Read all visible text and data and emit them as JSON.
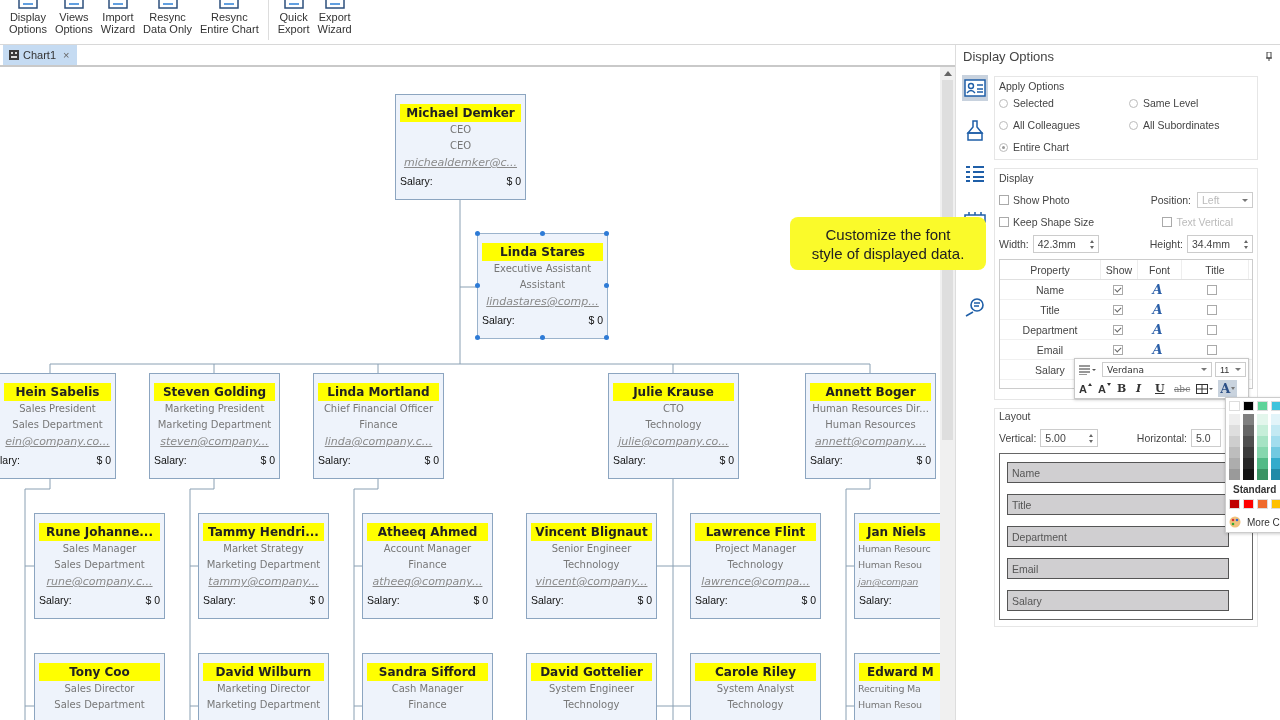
{
  "toolbar": {
    "groups": [
      [
        {
          "lines": [
            "Display",
            "Options"
          ]
        },
        {
          "lines": [
            "Views",
            "Options"
          ]
        },
        {
          "lines": [
            "Import",
            "Wizard"
          ]
        },
        {
          "lines": [
            "Resync",
            "Data Only"
          ]
        },
        {
          "lines": [
            "Resync",
            "Entire Chart"
          ]
        }
      ],
      [
        {
          "lines": [
            "Quick",
            "Export"
          ]
        },
        {
          "lines": [
            "Export",
            "Wizard"
          ]
        }
      ]
    ]
  },
  "tabs": [
    {
      "label": "Chart1",
      "close": "×",
      "selected": true
    }
  ],
  "chart": {
    "cards": [
      {
        "name": "Michael Demker",
        "title": "CEO",
        "department": "CEO",
        "email": "michealdemker@c...",
        "salary_label": "Salary:",
        "salary": "$ 0",
        "selected": false
      },
      {
        "name": "Linda Stares",
        "title": "Executive Assistant",
        "department": "Assistant",
        "email": "lindastares@comp...",
        "salary_label": "Salary:",
        "salary": "$ 0",
        "selected": true
      },
      {
        "name": "Hein Sabelis",
        "title": "Sales President",
        "department": "Sales Department",
        "email": "ein@company.co...",
        "salary_label": "lary:",
        "salary": "$ 0",
        "selected": false
      },
      {
        "name": "Steven Golding",
        "title": "Marketing President",
        "department": "Marketing Department",
        "email": "steven@company...",
        "salary_label": "Salary:",
        "salary": "$ 0",
        "selected": false
      },
      {
        "name": "Linda Mortland",
        "title": "Chief Financial Officer",
        "department": "Finance",
        "email": "linda@company.c...",
        "salary_label": "Salary:",
        "salary": "$ 0",
        "selected": false
      },
      {
        "name": "Julie Krause",
        "title": "CTO",
        "department": "Technology",
        "email": "julie@company.co...",
        "salary_label": "Salary:",
        "salary": "$ 0",
        "selected": false
      },
      {
        "name": "Annett Boger",
        "title": "Human Resources Dir...",
        "department": "Human Resources",
        "email": "annett@company....",
        "salary_label": "Salary:",
        "salary": "$ 0",
        "selected": false
      },
      {
        "name": "Rune Johanne...",
        "title": "Sales Manager",
        "department": "Sales Department",
        "email": "rune@company.c...",
        "salary_label": "Salary:",
        "salary": "$ 0",
        "selected": false
      },
      {
        "name": "Tammy Hendri...",
        "title": "Market Strategy",
        "department": "Marketing Department",
        "email": "tammy@company...",
        "salary_label": "Salary:",
        "salary": "$ 0",
        "selected": false
      },
      {
        "name": "Atheeq Ahmed",
        "title": "Account Manager",
        "department": "Finance",
        "email": "atheeq@company...",
        "salary_label": "Salary:",
        "salary": "$ 0",
        "selected": false
      },
      {
        "name": "Vincent Blignaut",
        "title": "Senior Engineer",
        "department": "Technology",
        "email": "vincent@company...",
        "salary_label": "Salary:",
        "salary": "$ 0",
        "selected": false
      },
      {
        "name": "Lawrence Flint",
        "title": "Project Manager",
        "department": "Technology",
        "email": "lawrence@compa...",
        "salary_label": "Salary:",
        "salary": "$ 0",
        "selected": false
      },
      {
        "name": "Jan Niels",
        "title": "Human Resourc",
        "department": "Human Resou",
        "email": "jan@compan",
        "salary_label": "Salary:",
        "selected": false
      },
      {
        "name": "Tony Coo",
        "title": "Sales Director",
        "department": "Sales Department",
        "selected": false
      },
      {
        "name": "David Wilburn",
        "title": "Marketing Director",
        "department": "Marketing Department",
        "selected": false
      },
      {
        "name": "Sandra Sifford",
        "title": "Cash Manager",
        "department": "Finance",
        "selected": false
      },
      {
        "name": "David Gottelier",
        "title": "System Engineer",
        "department": "Technology",
        "selected": false
      },
      {
        "name": "Carole Riley",
        "title": "System Analyst",
        "department": "Technology",
        "selected": false
      },
      {
        "name": "Edward M",
        "title": "Recruiting Ma",
        "department": "Human Resou",
        "selected": false
      }
    ]
  },
  "callout": {
    "lines": [
      "Customize the font",
      "style of displayed data."
    ]
  },
  "panel": {
    "title": "Display Options",
    "side_icons": [
      {
        "selected": true
      },
      {
        "selected": false
      },
      {
        "selected": false
      },
      {
        "selected": false
      },
      {
        "selected": false
      }
    ],
    "apply_options": {
      "title": "Apply Options",
      "options": [
        {
          "label": "Selected",
          "selected": false
        },
        {
          "label": "Same Level",
          "selected": false
        },
        {
          "label": "All Colleagues",
          "selected": false
        },
        {
          "label": "All Subordinates",
          "selected": false
        },
        {
          "label": "Entire Chart",
          "selected": true
        }
      ]
    },
    "display": {
      "title": "Display",
      "show_photo": {
        "label": "Show Photo",
        "checked": false
      },
      "position": {
        "label": "Position:",
        "value": "Left",
        "disabled": true
      },
      "keep_shape_size": {
        "label": "Keep Shape Size",
        "checked": false
      },
      "text_vertical": {
        "label": "Text Vertical",
        "checked": false,
        "disabled": true
      },
      "width": {
        "label": "Width:",
        "value": "42.3mm"
      },
      "height": {
        "label": "Height:",
        "value": "34.4mm"
      },
      "table": {
        "columns": [
          "Property",
          "Show",
          "Font",
          "Title"
        ],
        "rows": [
          {
            "property": "Name",
            "show": true,
            "font": "A",
            "title": false
          },
          {
            "property": "Title",
            "show": true,
            "font": "A",
            "title": false
          },
          {
            "property": "Department",
            "show": true,
            "font": "A",
            "title": false
          },
          {
            "property": "Email",
            "show": true,
            "font": "A",
            "title": false
          },
          {
            "property": "Salary"
          }
        ]
      }
    },
    "font_popup": {
      "font": "Verdana",
      "size": "11",
      "tools": [
        {
          "kind": "grow",
          "text": "A",
          "selected": false
        },
        {
          "kind": "shrink",
          "text": "A",
          "selected": false
        },
        {
          "kind": "bold",
          "text": "B",
          "selected": false
        },
        {
          "kind": "italic",
          "text": "I",
          "selected": false
        },
        {
          "kind": "underline",
          "text": "U",
          "selected": false
        },
        {
          "kind": "strike",
          "text": "abc",
          "selected": false
        },
        {
          "kind": "table",
          "selected": false
        },
        {
          "kind": "color",
          "text": "A",
          "selected": true
        }
      ]
    },
    "palette": {
      "top": [
        {
          "color": "#ffffff"
        },
        {
          "color": "#000000"
        },
        {
          "color": "#5fd39a"
        },
        {
          "color": "#3ec3dc"
        }
      ],
      "shades": [
        [
          {
            "color": "#eeeeee"
          },
          {
            "color": "#dedede"
          },
          {
            "color": "#cecece"
          },
          {
            "color": "#bdbdbd"
          },
          {
            "color": "#adadad"
          },
          {
            "color": "#9a9a9a"
          }
        ],
        [
          {
            "color": "#808080"
          },
          {
            "color": "#666666"
          },
          {
            "color": "#4f4f4f"
          },
          {
            "color": "#3b3b3b"
          },
          {
            "color": "#262626"
          },
          {
            "color": "#141414"
          }
        ],
        [
          {
            "color": "#e3f6ec"
          },
          {
            "color": "#c6eed9"
          },
          {
            "color": "#a6e3c4"
          },
          {
            "color": "#86d7ae"
          },
          {
            "color": "#52ba86"
          },
          {
            "color": "#3a9464"
          }
        ],
        [
          {
            "color": "#e2f4f9"
          },
          {
            "color": "#c3e9f3"
          },
          {
            "color": "#a2ddee"
          },
          {
            "color": "#72c9e1"
          },
          {
            "color": "#33abcc"
          },
          {
            "color": "#218aa8"
          }
        ]
      ],
      "standard_label": "Standard",
      "standard": [
        {
          "color": "#c00000"
        },
        {
          "color": "#ff0000"
        },
        {
          "color": "#f06a2c"
        },
        {
          "color": "#ffc000"
        }
      ],
      "more": "More C"
    },
    "layout": {
      "title": "Layout",
      "vertical": {
        "label": "Vertical:",
        "value": "5.00"
      },
      "horizontal": {
        "label": "Horizontal:",
        "value": "5.0"
      },
      "fields": [
        "Name",
        "Title",
        "Department",
        "Email",
        "Salary"
      ]
    }
  }
}
